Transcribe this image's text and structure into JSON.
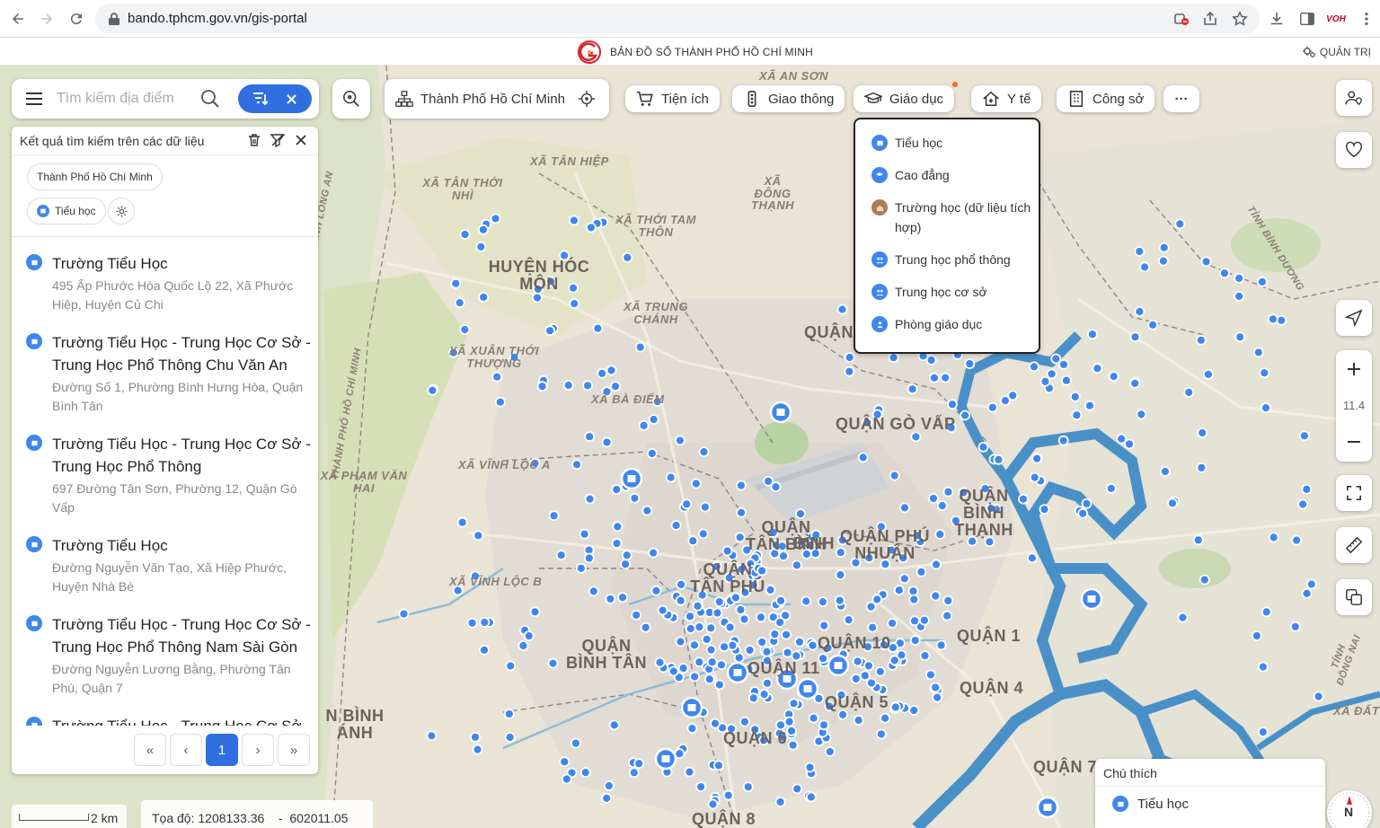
{
  "browser": {
    "url": "bando.tphcm.gov.vn/gis-portal",
    "brand_icon_text": "VOH"
  },
  "header": {
    "title": "BẢN ĐỒ SỐ THÀNH PHỐ HỒ CHÍ MINH",
    "admin_label": "QUẢN TRỊ"
  },
  "search": {
    "placeholder": "Tìm kiếm địa điểm"
  },
  "toolbar": {
    "city": "Thành Phố Hồ Chí Minh",
    "categories": [
      {
        "label": "Tiện ích",
        "icon": "cart-icon"
      },
      {
        "label": "Giao thông",
        "icon": "traffic-light-icon"
      },
      {
        "label": "Giáo dục",
        "icon": "graduation-cap-icon"
      },
      {
        "label": "Y tế",
        "icon": "medical-house-icon"
      },
      {
        "label": "Công sở",
        "icon": "office-building-icon"
      }
    ],
    "more_label": "···"
  },
  "education_dropdown": {
    "items": [
      {
        "label": "Tiểu học",
        "color": "#3f86ef"
      },
      {
        "label": "Cao đẳng",
        "color": "#3f86ef"
      },
      {
        "label": "Trường học (dữ liệu tích hợp)",
        "color": "#b07a58"
      },
      {
        "label": "Trung học phổ thông",
        "color": "#3f86ef"
      },
      {
        "label": "Trung học cơ sở",
        "color": "#3f86ef"
      },
      {
        "label": "Phòng giáo dục",
        "color": "#3f86ef"
      }
    ]
  },
  "results_panel": {
    "title": "Kết quả tìm kiếm trên các dữ liệu",
    "chips": [
      "Thành Phố Hồ Chí Minh",
      "Tiểu học"
    ],
    "results": [
      {
        "name": "Trường Tiểu Học",
        "address": "495 Ấp Phước Hòa Quốc Lộ 22, Xã Phước Hiệp, Huyện Củ Chi"
      },
      {
        "name": "Trường Tiểu Học - Trung Học Cơ Sở - Trung Học Phổ Thông Chu Văn An",
        "address": "Đường Số 1, Phường Bình Hưng Hòa, Quận Bình Tân"
      },
      {
        "name": "Trường Tiểu Học - Trung Học Cơ Sở - Trung Học Phổ Thông",
        "address": "697 Đường Tân Sơn, Phường 12, Quận Gò Vấp"
      },
      {
        "name": "Trường Tiểu Học",
        "address": "Đường Nguyễn Văn Tạo, Xã Hiệp Phước, Huyện Nhà Bè"
      },
      {
        "name": "Trường Tiểu Học - Trung Học Cơ Sở - Trung Học Phổ Thông Nam Sài Gòn",
        "address": "Đường Nguyễn Lương Bằng, Phường Tân Phú, Quận 7"
      },
      {
        "name": "Trường Tiểu Học - Trung Học Cơ Sở",
        "address": ""
      }
    ],
    "pagination": {
      "first": "«",
      "prev": "‹",
      "current": "1",
      "next": "›",
      "last": "»"
    }
  },
  "map": {
    "labels": [
      "XÃ AN SƠN",
      "XÃ TÂN HIỆP",
      "XÃ TÂN THỚI NHÌ",
      "XÃ ĐÔNG THẠNH",
      "XÃ THỚI TAM THÔN",
      "HUYỆN HÓC MÔN",
      "XÃ TRUNG CHÁNH",
      "XÃ XUÂN THỚI THƯỢNG",
      "XÃ BÀ ĐIỂM",
      "QUẬN GÒ VẤP",
      "XÃ VĨNH LỘC A",
      "XÃ PHẠM VĂN HAI",
      "QUẬN BÌNH THẠNH",
      "QUẬN TÂN BÌNH",
      "QUẬN PHÚ NHUẬN",
      "QUẬN TÂN PHÚ",
      "XÃ VĨNH LỘC B",
      "QUẬN BÌNH TÂN",
      "QUẬN 10",
      "QUẬN 11",
      "QUẬN 1",
      "QUẬN 5",
      "QUẬN 4",
      "QUẬN 6",
      "QUẬN 8",
      "QUẬN 7",
      "N BÌNH ÁNH",
      "XÃ ĐẤT",
      "TỈNH LONG AN",
      "THÀNH PHỐ HỒ CHÍ MINH",
      "TỈNH BÌNH DƯƠNG",
      "TỈNH ĐỒNG NAI",
      "QUẬN",
      "BÌNH"
    ],
    "zoom_level": "11.4",
    "scale_label": "2 km",
    "coordinates_label": "Tọa độ: 1208133.36    -  602011.05"
  },
  "legend": {
    "title": "Chú thích",
    "items": [
      "Tiểu học"
    ]
  },
  "compass_label": "N",
  "colors": {
    "accent": "#2f6fe0",
    "marker": "#3f86ef",
    "river": "#4a90c8"
  }
}
